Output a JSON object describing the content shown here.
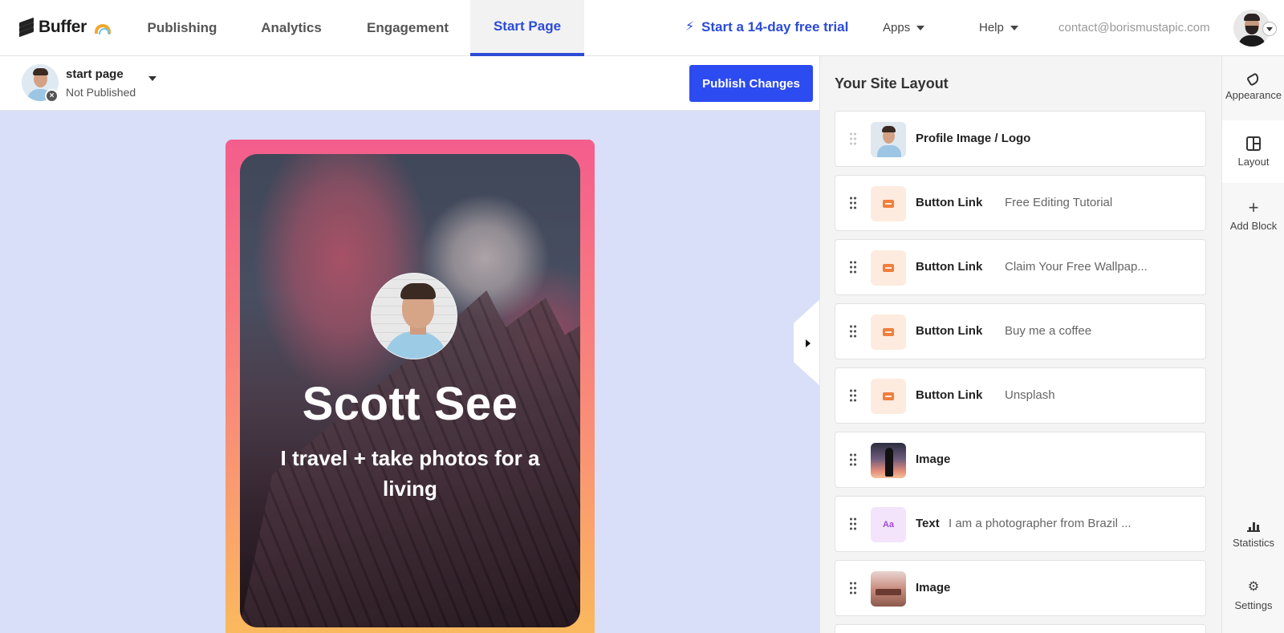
{
  "app": {
    "logo_text": "Buffer",
    "nav_tabs": [
      {
        "label": "Publishing"
      },
      {
        "label": "Analytics"
      },
      {
        "label": "Engagement"
      },
      {
        "label": "Start Page",
        "active": true
      }
    ],
    "trial_label": "Start a 14-day free trial",
    "apps_label": "Apps",
    "help_label": "Help",
    "account_email": "contact@borismustapic.com"
  },
  "page_header": {
    "page_name": "start page",
    "page_status": "Not Published",
    "publish_label": "Publish Changes"
  },
  "preview": {
    "name": "Scott See",
    "bio": "I travel + take photos for a living"
  },
  "layout_panel": {
    "title": "Your Site Layout",
    "blocks": [
      {
        "type": "Profile Image / Logo",
        "desc": "",
        "thumb": "profile"
      },
      {
        "type": "Button Link",
        "desc": "Free Editing Tutorial",
        "thumb": "button"
      },
      {
        "type": "Button Link",
        "desc": "Claim Your Free Wallpap...",
        "thumb": "button"
      },
      {
        "type": "Button Link",
        "desc": "Buy me a coffee",
        "thumb": "button"
      },
      {
        "type": "Button Link",
        "desc": "Unsplash",
        "thumb": "button"
      },
      {
        "type": "Image",
        "desc": "",
        "thumb": "image"
      },
      {
        "type": "Text",
        "desc": "I am a photographer from Brazil ...",
        "thumb": "text"
      },
      {
        "type": "Image",
        "desc": "",
        "thumb": "image"
      }
    ],
    "text_thumb_label": "Aa"
  },
  "rail": {
    "appearance": "Appearance",
    "layout": "Layout",
    "add_block": "Add Block",
    "statistics": "Statistics",
    "settings": "Settings"
  },
  "colors": {
    "accent": "#2c4bd7",
    "publish_button": "#2c4bf0",
    "preview_bg": "#d9dff8",
    "button_thumb": "#f07f3c"
  }
}
